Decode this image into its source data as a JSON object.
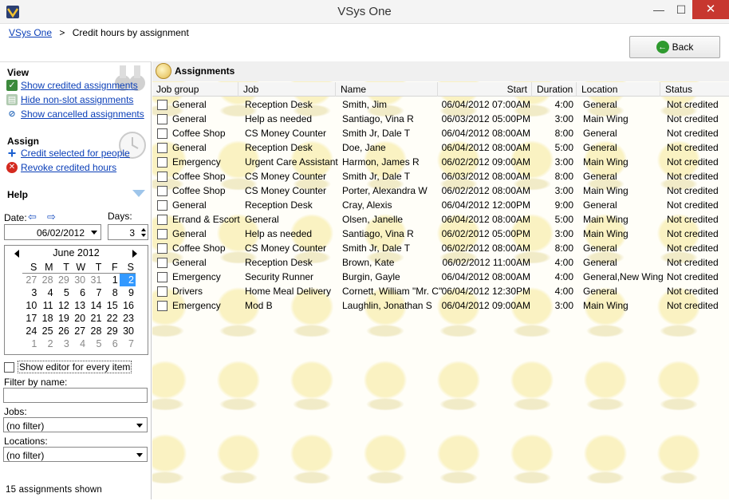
{
  "window": {
    "title": "VSys One",
    "minimize": "—",
    "maximize": "☐",
    "close": "✕"
  },
  "breadcrumb": {
    "root": "VSys One",
    "separator": ">",
    "current": "Credit hours by assignment"
  },
  "back_button": {
    "label": "Back"
  },
  "view": {
    "heading": "View",
    "items": [
      {
        "label": "Show credited assignments",
        "icon": "check-icon"
      },
      {
        "label": "Hide non-slot assignments",
        "icon": "hide-icon"
      },
      {
        "label": "Show cancelled assignments",
        "icon": "cancel-icon"
      }
    ]
  },
  "assign": {
    "heading": "Assign",
    "items": [
      {
        "label": "Credit selected for people",
        "icon": "plus-icon"
      },
      {
        "label": "Revoke credited hours",
        "icon": "revoke-icon"
      }
    ]
  },
  "help": {
    "heading": "Help"
  },
  "date": {
    "label": "Date:",
    "value": "06/02/2012",
    "prev": "⇦",
    "next": "⇨"
  },
  "days": {
    "label": "Days:",
    "value": "3"
  },
  "calendar": {
    "title": "June 2012",
    "dow": [
      "S",
      "M",
      "T",
      "W",
      "T",
      "F",
      "S"
    ],
    "weeks": [
      [
        "27",
        "28",
        "29",
        "30",
        "31",
        "1",
        "2"
      ],
      [
        "3",
        "4",
        "5",
        "6",
        "7",
        "8",
        "9"
      ],
      [
        "10",
        "11",
        "12",
        "13",
        "14",
        "15",
        "16"
      ],
      [
        "17",
        "18",
        "19",
        "20",
        "21",
        "22",
        "23"
      ],
      [
        "24",
        "25",
        "26",
        "27",
        "28",
        "29",
        "30"
      ],
      [
        "1",
        "2",
        "3",
        "4",
        "5",
        "6",
        "7"
      ]
    ],
    "selected": "2"
  },
  "show_editor": {
    "label": "Show editor for every item"
  },
  "filter_name": {
    "label": "Filter by name:",
    "value": ""
  },
  "jobs_filter": {
    "label": "Jobs:",
    "value": "(no filter)"
  },
  "locations_filter": {
    "label": "Locations:",
    "value": "(no filter)"
  },
  "status": "15  assignments shown",
  "assignments": {
    "title": "Assignments",
    "columns": [
      "Job group",
      "Job",
      "Name",
      "Start",
      "Duration",
      "Location",
      "Status"
    ],
    "rows": [
      [
        "General",
        "Reception Desk",
        "Smith, Jim",
        "06/04/2012 07:00AM",
        "4:00",
        "General",
        "Not credited"
      ],
      [
        "General",
        "Help as needed",
        "Santiago, Vina R",
        "06/03/2012 05:00PM",
        "3:00",
        "Main Wing",
        "Not credited"
      ],
      [
        "Coffee Shop",
        "CS Money Counter",
        "Smith Jr, Dale T",
        "06/04/2012 08:00AM",
        "8:00",
        "General",
        "Not credited"
      ],
      [
        "General",
        "Reception Desk",
        "Doe, Jane",
        "06/04/2012 08:00AM",
        "5:00",
        "General",
        "Not credited"
      ],
      [
        "Emergency",
        "Urgent Care Assistant",
        "Harmon, James R",
        "06/02/2012 09:00AM",
        "3:00",
        "Main Wing",
        "Not credited"
      ],
      [
        "Coffee Shop",
        "CS Money Counter",
        "Smith Jr, Dale T",
        "06/03/2012 08:00AM",
        "8:00",
        "General",
        "Not credited"
      ],
      [
        "Coffee Shop",
        "CS Money Counter",
        "Porter, Alexandra W",
        "06/02/2012 08:00AM",
        "3:00",
        "Main Wing",
        "Not credited"
      ],
      [
        "General",
        "Reception Desk",
        "Cray, Alexis",
        "06/04/2012 12:00PM",
        "9:00",
        "General",
        "Not credited"
      ],
      [
        "Errand & Escort",
        "General",
        "Olsen, Janelle",
        "06/04/2012 08:00AM",
        "5:00",
        "Main Wing",
        "Not credited"
      ],
      [
        "General",
        "Help as needed",
        "Santiago, Vina R",
        "06/02/2012 05:00PM",
        "3:00",
        "Main Wing",
        "Not credited"
      ],
      [
        "Coffee Shop",
        "CS Money Counter",
        "Smith Jr, Dale T",
        "06/02/2012 08:00AM",
        "8:00",
        "General",
        "Not credited"
      ],
      [
        "General",
        "Reception Desk",
        "Brown, Kate",
        "06/02/2012 11:00AM",
        "4:00",
        "General",
        "Not credited"
      ],
      [
        "Emergency",
        "Security Runner",
        "Burgin, Gayle",
        "06/04/2012 08:00AM",
        "4:00",
        "General,New Wing",
        "Not credited"
      ],
      [
        "Drivers",
        "Home Meal Delivery",
        "Cornett, William \"Mr. C\"",
        "06/04/2012 12:30PM",
        "4:00",
        "General",
        "Not credited"
      ],
      [
        "Emergency",
        "Mod B",
        "Laughlin, Jonathan S",
        "06/04/2012 09:00AM",
        "3:00",
        "Main Wing",
        "Not credited"
      ]
    ]
  }
}
